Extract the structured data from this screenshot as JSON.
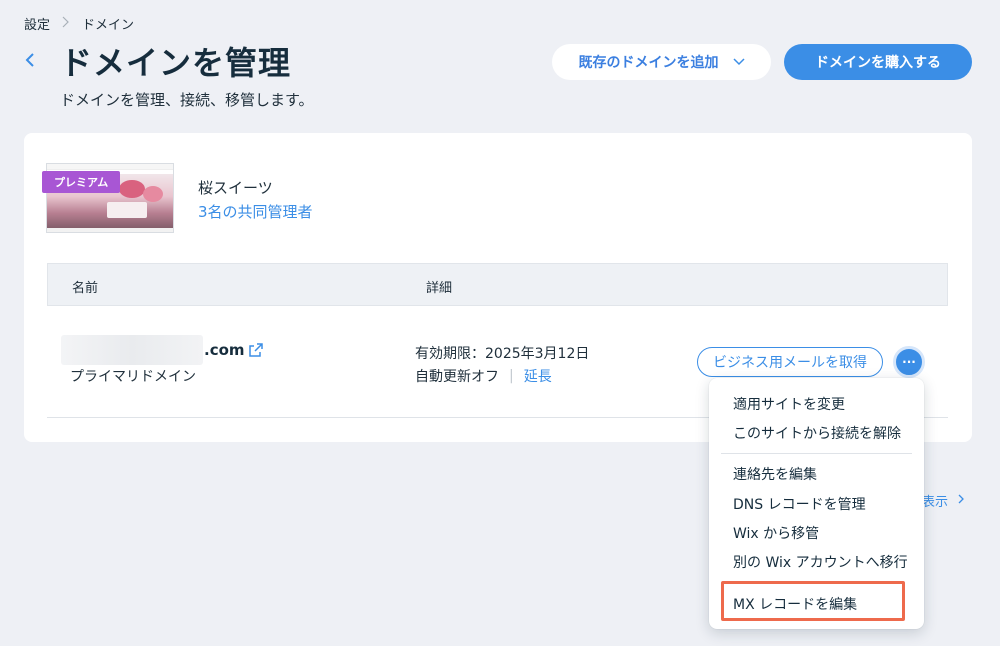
{
  "breadcrumb": {
    "root": "設定",
    "current": "ドメイン"
  },
  "header": {
    "title": "ドメインを管理",
    "subtitle": "ドメインを管理、接続、移管します。",
    "add_existing_label": "既存のドメインを追加",
    "buy_domain_label": "ドメインを購入する"
  },
  "site": {
    "premium_badge": "プレミアム",
    "name": "桜スイーツ",
    "collaborators": "3名の共同管理者"
  },
  "table": {
    "headers": {
      "name": "名前",
      "detail": "詳細"
    },
    "row": {
      "domain_suffix": ".com",
      "domain_type": "プライマリドメイン",
      "expiry": "有効期限：2025年3月12日",
      "auto_renew": "自動更新オフ",
      "renew_separator": "|",
      "extend": "延長",
      "email_button": "ビジネス用メールを取得",
      "more_button": "···"
    }
  },
  "show_more": {
    "label": "表示"
  },
  "menu": {
    "items": [
      "適用サイトを変更",
      "このサイトから接続を解除",
      "連絡先を編集",
      "DNS レコードを管理",
      "Wix から移管",
      "別の Wix アカウントへ移行",
      "MX レコードを編集"
    ],
    "highlighted_item": "MX レコードを編集"
  },
  "colors": {
    "accent": "#3b8ee6",
    "premium": "#a856d4",
    "highlight": "#ee6a4c",
    "background": "#eef0f5"
  }
}
